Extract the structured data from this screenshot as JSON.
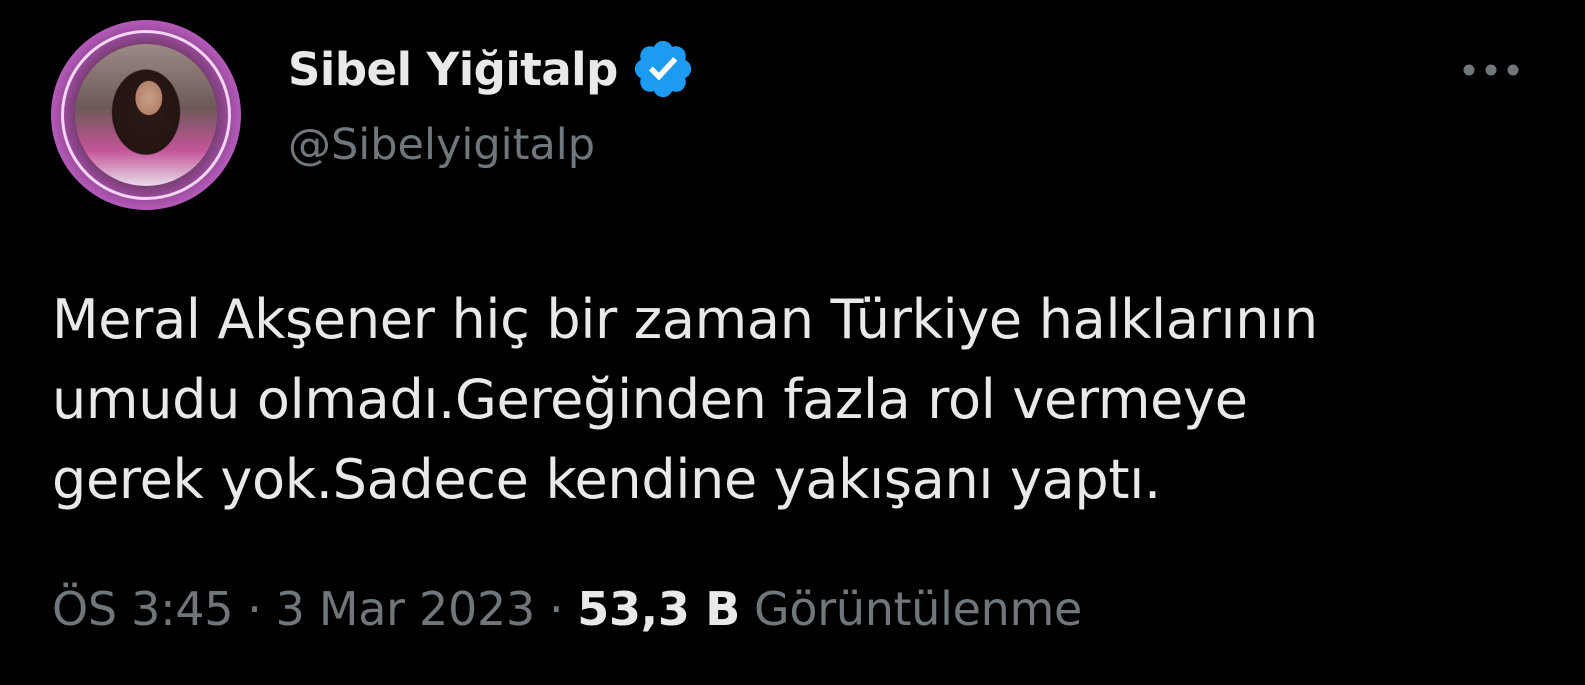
{
  "tweet": {
    "display_name": "Sibel Yiğitalp",
    "handle": "@Sibelyigitalp",
    "verified_icon": "verified-badge-icon",
    "more_icon": "more-options-icon",
    "text_lines": [
      "Meral Akşener hiç bir zaman Türkiye halklarının",
      "umudu olmadı.Gereğinden fazla rol vermeye",
      "gerek yok.Sadece kendine yakışanı yaptı."
    ],
    "time": "ÖS 3:45",
    "separator": "·",
    "date": "3 Mar 2023",
    "views_count": "53,3 B",
    "views_label": "Görüntülenme"
  },
  "colors": {
    "background": "#000000",
    "primary_text": "#e7e9ea",
    "secondary_text": "#71767b",
    "verified_blue": "#1d9bf0",
    "avatar_ring": "#b35ab8"
  }
}
